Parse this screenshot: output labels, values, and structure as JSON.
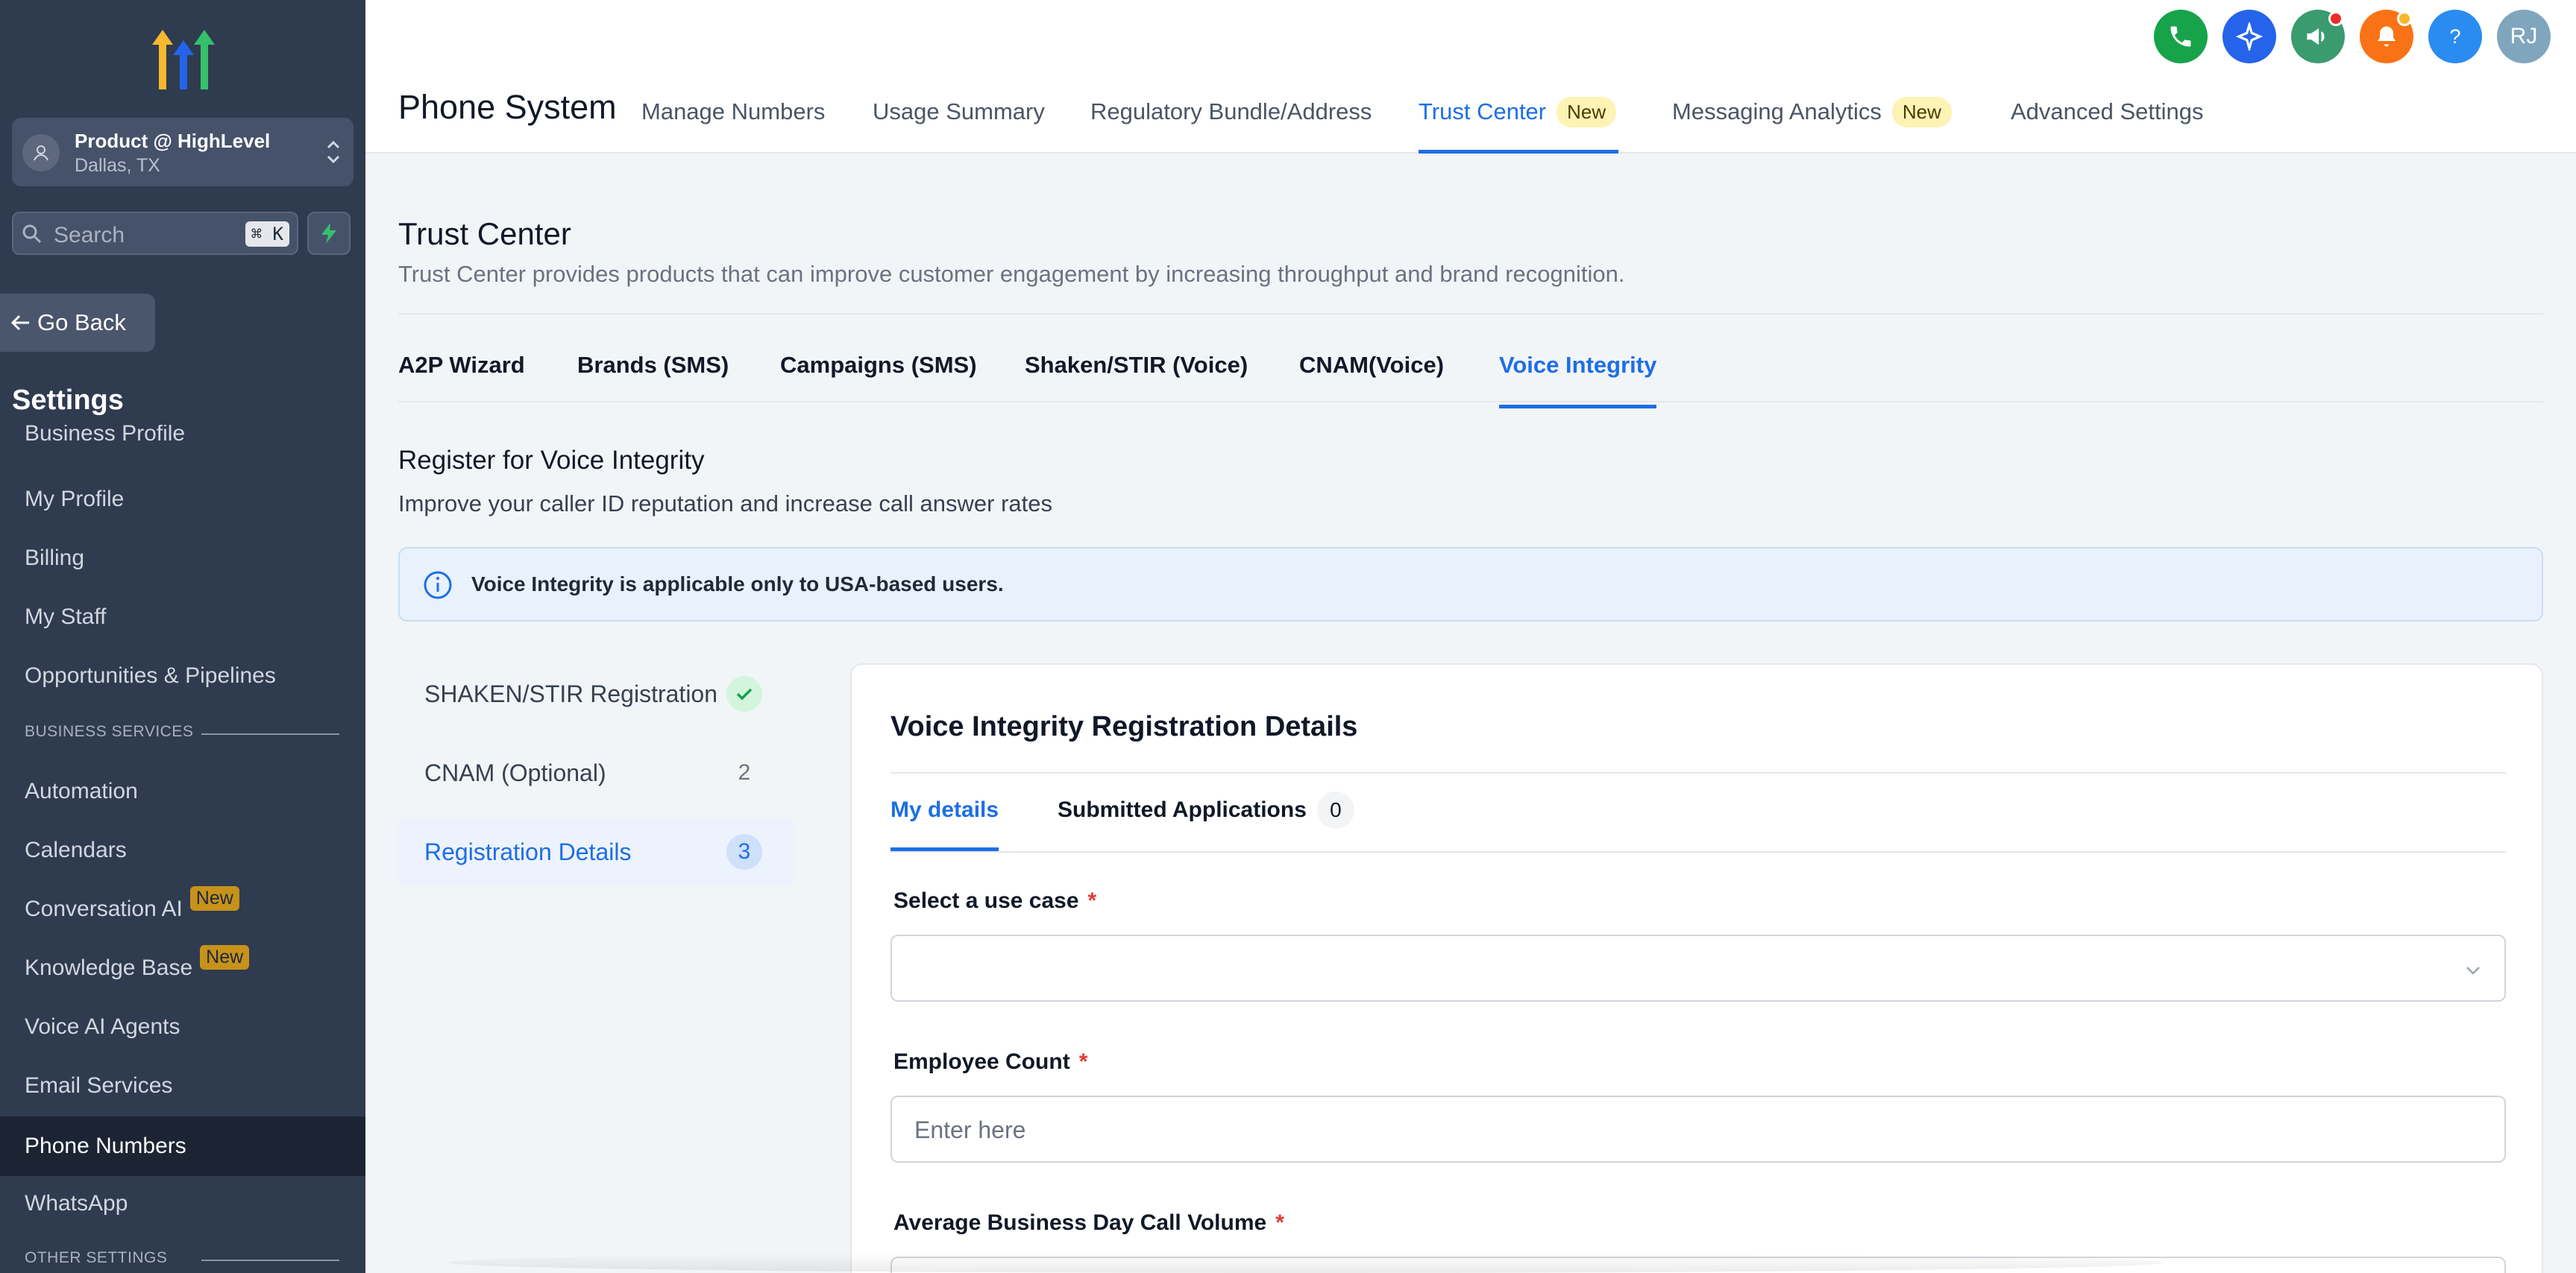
{
  "sidebar": {
    "location": {
      "name": "Product @ HighLevel",
      "city": "Dallas, TX"
    },
    "search": {
      "placeholder": "Search",
      "shortcut": "⌘ K"
    },
    "go_back": "Go Back",
    "title": "Settings",
    "items": [
      {
        "label": "Business Profile"
      },
      {
        "label": "My Profile"
      },
      {
        "label": "Billing"
      },
      {
        "label": "My Staff"
      },
      {
        "label": "Opportunities & Pipelines"
      },
      {
        "section": "BUSINESS SERVICES"
      },
      {
        "label": "Automation"
      },
      {
        "label": "Calendars"
      },
      {
        "label": "Conversation AI",
        "badge": "New"
      },
      {
        "label": "Knowledge Base",
        "badge": "New"
      },
      {
        "label": "Voice AI Agents"
      },
      {
        "label": "Email Services"
      },
      {
        "label": "Phone Numbers",
        "active": true
      },
      {
        "label": "WhatsApp"
      },
      {
        "section": "OTHER SETTINGS"
      }
    ]
  },
  "topbar": {
    "icons": [
      {
        "name": "phone-icon",
        "color": "#16a34a"
      },
      {
        "name": "sparkle-icon",
        "color": "#2563eb"
      },
      {
        "name": "megaphone-icon",
        "color": "#3a9b6e"
      },
      {
        "name": "bell-icon",
        "color": "#f97316"
      },
      {
        "name": "help-icon",
        "color": "#2a8cf0"
      }
    ],
    "avatar_initials": "RJ"
  },
  "header": {
    "title": "Phone System",
    "tabs": [
      {
        "label": "Manage Numbers"
      },
      {
        "label": "Usage Summary"
      },
      {
        "label": "Regulatory Bundle/Address"
      },
      {
        "label": "Trust Center",
        "badge": "New",
        "active": true
      },
      {
        "label": "Messaging Analytics",
        "badge": "New"
      },
      {
        "label": "Advanced Settings"
      }
    ]
  },
  "trust_center": {
    "title": "Trust Center",
    "description": "Trust Center provides products that can improve customer engagement by increasing throughput and brand recognition.",
    "tabs": [
      {
        "label": "A2P Wizard"
      },
      {
        "label": "Brands (SMS)"
      },
      {
        "label": "Campaigns (SMS)"
      },
      {
        "label": "Shaken/STIR (Voice)"
      },
      {
        "label": "CNAM(Voice)"
      },
      {
        "label": "Voice Integrity",
        "active": true
      }
    ],
    "register_title": "Register for Voice Integrity",
    "register_subtitle": "Improve your caller ID reputation and increase call answer rates",
    "info_banner": "Voice Integrity is applicable only to USA-based users.",
    "steps": [
      {
        "label": "SHAKEN/STIR Registration",
        "status": "complete"
      },
      {
        "label": "CNAM (Optional)",
        "number": "2"
      },
      {
        "label": "Registration Details",
        "number": "3",
        "active": true
      }
    ]
  },
  "form": {
    "title": "Voice Integrity Registration Details",
    "tabs": [
      {
        "label": "My details",
        "active": true
      },
      {
        "label": "Submitted Applications",
        "count": "0"
      }
    ],
    "fields": [
      {
        "label": "Select a use case",
        "required": "*",
        "type": "select",
        "value": ""
      },
      {
        "label": "Employee Count",
        "required": "*",
        "type": "text",
        "placeholder": "Enter here"
      },
      {
        "label": "Average Business Day Call Volume",
        "required": "*",
        "type": "text",
        "placeholder": ""
      }
    ]
  }
}
